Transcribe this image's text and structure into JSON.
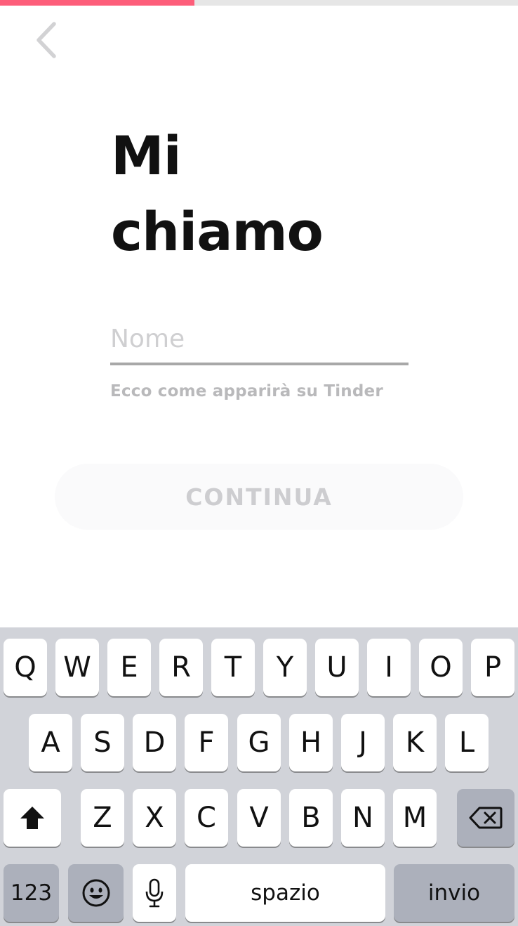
{
  "progress": {
    "fraction": 0.375,
    "color": "#fd5e7a"
  },
  "header": {
    "back_icon": "chevron-left-icon"
  },
  "title": {
    "line1": "Mi",
    "line2": "chiamo"
  },
  "name_field": {
    "placeholder": "Nome",
    "value": ""
  },
  "helper_text": "Ecco come apparirà su Tinder",
  "continue_label": "CONTINUA",
  "keyboard": {
    "row1": [
      "Q",
      "W",
      "E",
      "R",
      "T",
      "Y",
      "U",
      "I",
      "O",
      "P"
    ],
    "row2": [
      "A",
      "S",
      "D",
      "F",
      "G",
      "H",
      "J",
      "K",
      "L"
    ],
    "row3": [
      "Z",
      "X",
      "C",
      "V",
      "B",
      "N",
      "M"
    ],
    "shift_icon": "shift-icon",
    "backspace_icon": "backspace-icon",
    "numbers_label": "123",
    "emoji_icon": "emoji-icon",
    "mic_icon": "microphone-icon",
    "space_label": "spazio",
    "return_label": "invio"
  }
}
